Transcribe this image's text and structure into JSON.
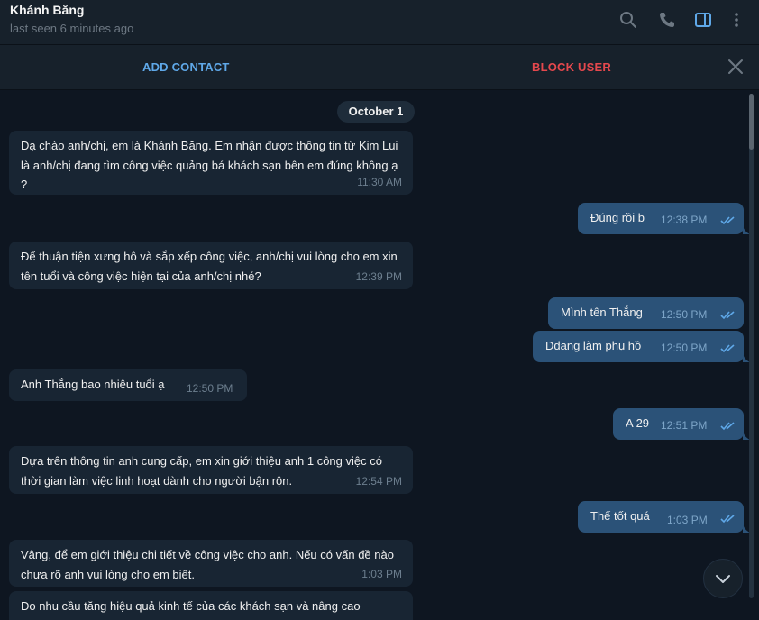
{
  "header": {
    "contact_name": "Khánh Băng",
    "status": "last seen 6 minutes ago",
    "icons": [
      "search-icon",
      "phone-icon",
      "sidebar-panel-icon",
      "more-vertical-icon"
    ]
  },
  "actionbar": {
    "add_contact": "ADD CONTACT",
    "block_user": "BLOCK USER",
    "close_icon": "close-icon"
  },
  "date_separator": "October 1",
  "messages": [
    {
      "dir": "in",
      "text": "Dạ chào anh/chị, em là Khánh Băng. Em nhận được thông tin từ Kim Lui là anh/chị đang tìm công việc quảng bá khách sạn bên em đúng không ạ ?",
      "time": "11:30 AM"
    },
    {
      "dir": "out",
      "text": "Đúng rồi b",
      "time": "12:38 PM",
      "read": true
    },
    {
      "dir": "in",
      "text": "Để thuận tiện xưng hô và sắp xếp công việc, anh/chị vui lòng cho em xin tên tuổi và công việc hiện tại của anh/chị nhé?",
      "time": "12:39 PM"
    },
    {
      "dir": "out",
      "text": "Mình tên Thắng",
      "time": "12:50 PM",
      "read": true
    },
    {
      "dir": "out",
      "text": "Ddang làm phụ hồ",
      "time": "12:50 PM",
      "read": true
    },
    {
      "dir": "in",
      "text": "Anh Thắng bao nhiêu tuổi ạ",
      "time": "12:50 PM"
    },
    {
      "dir": "out",
      "text": "A 29",
      "time": "12:51 PM",
      "read": true
    },
    {
      "dir": "in",
      "text": "Dựa trên thông tin anh cung cấp, em xin giới thiệu anh 1 công việc có thời gian làm việc linh hoạt dành cho người bận rộn.",
      "time": "12:54 PM"
    },
    {
      "dir": "out",
      "text": "Thế tốt quá",
      "time": "1:03 PM",
      "read": true
    },
    {
      "dir": "in",
      "text": "Vâng, để em giới thiệu chi tiết về công việc cho anh. Nếu có vấn đề nào chưa rõ anh vui lòng cho em biết.",
      "time": "1:03 PM"
    },
    {
      "dir": "in",
      "text": "Do nhu cầu tăng hiệu quả kinh tế của các khách sạn và nâng cao",
      "time": ""
    }
  ],
  "colors": {
    "background": "#0e1621",
    "header": "#17212b",
    "incoming_bubble": "#182533",
    "outgoing_bubble": "#2b5278",
    "accent_blue": "#5fa8e8",
    "danger_red": "#e5484d"
  }
}
